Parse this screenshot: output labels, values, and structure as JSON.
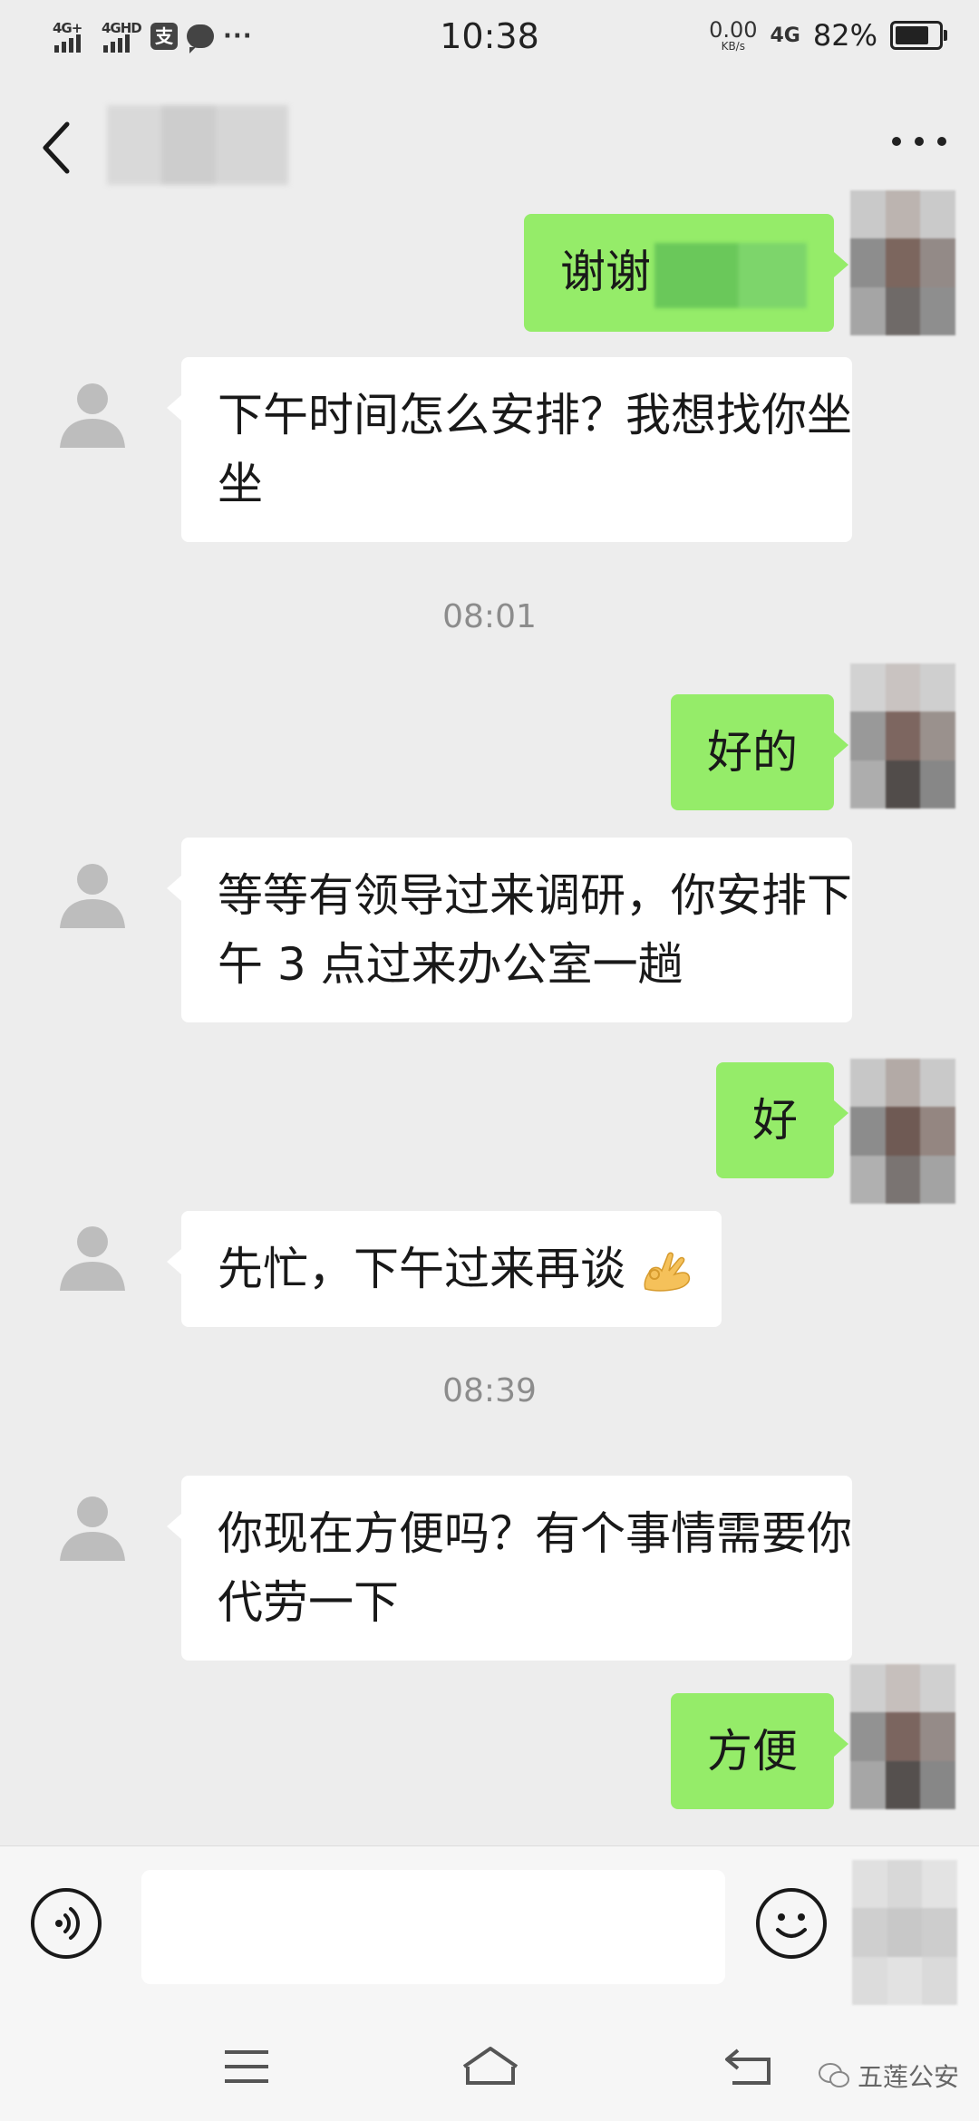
{
  "status_bar": {
    "time": "10:38",
    "net1": "4G+",
    "net2": "4GHD",
    "alipay": "支",
    "more": "···",
    "speed_value": "0.00",
    "speed_unit": "KB/s",
    "net3": "4G",
    "battery": "82%"
  },
  "chat": {
    "messages": [
      {
        "side": "out",
        "text": "谢谢"
      },
      {
        "side": "in",
        "text": "下午时间怎么安排？我想找你坐坐"
      },
      {
        "timestamp": "08:01"
      },
      {
        "side": "out",
        "text": "好的"
      },
      {
        "side": "in",
        "text": "等等有领导过来调研，你安排下午 3 点过来办公室一趟"
      },
      {
        "side": "out",
        "text": "好"
      },
      {
        "side": "in",
        "text": "先忙，下午过来再谈"
      },
      {
        "timestamp": "08:39"
      },
      {
        "side": "in",
        "text": "你现在方便吗？有个事情需要你代劳一下"
      },
      {
        "side": "out",
        "text": "方便"
      }
    ]
  },
  "input_bar": {
    "placeholder": ""
  },
  "watermark": {
    "text": "五莲公安"
  },
  "colors": {
    "background": "#ededed",
    "bubble_out": "#95ec69",
    "bubble_in": "#ffffff"
  }
}
